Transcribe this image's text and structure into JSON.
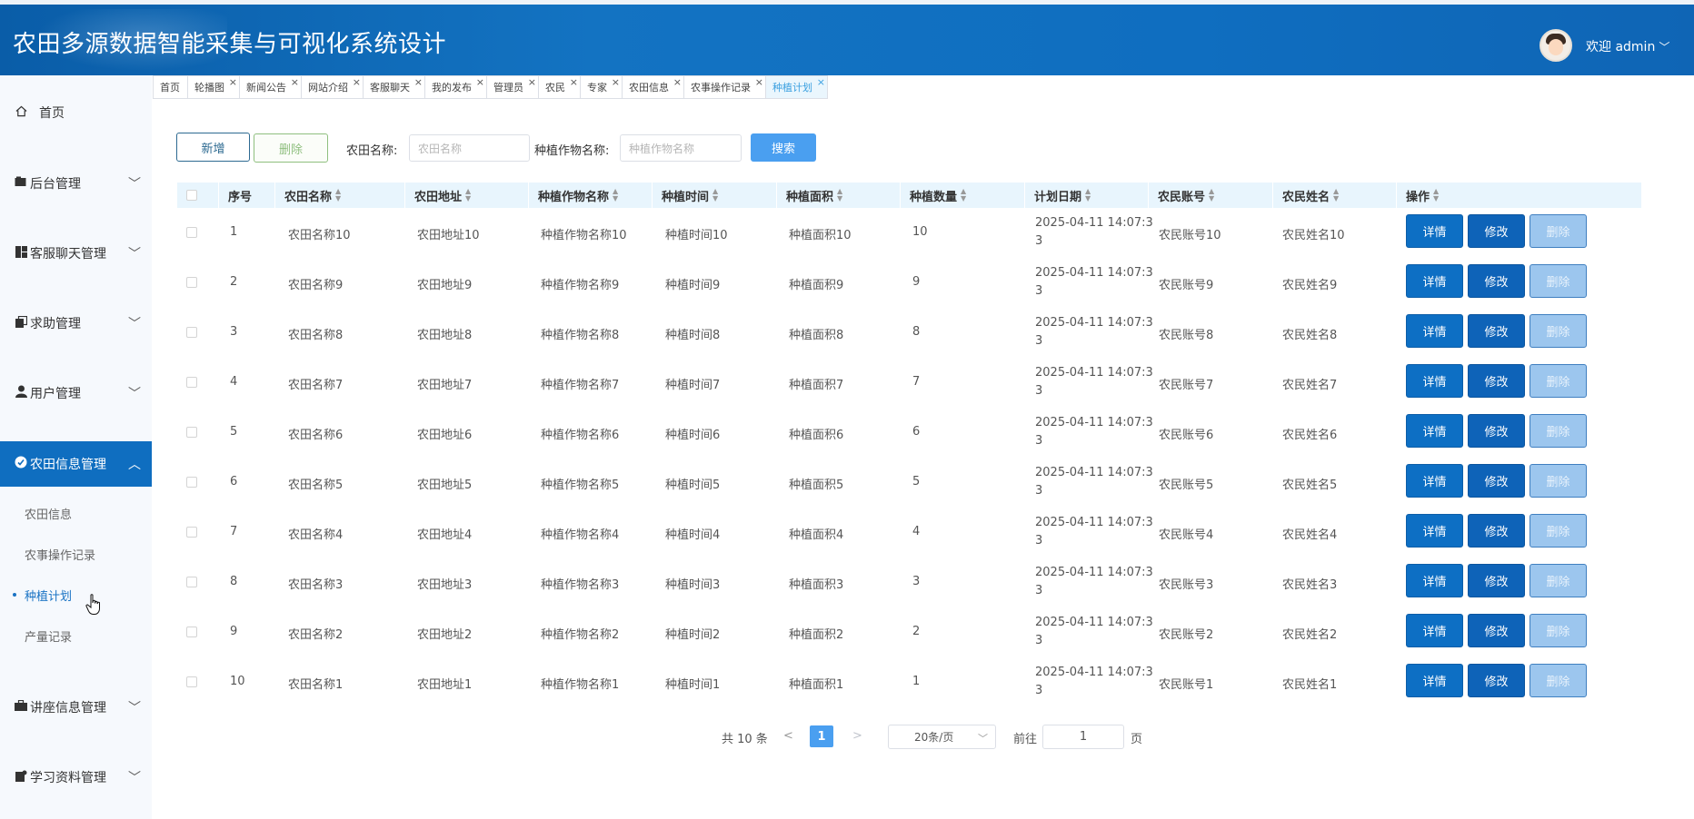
{
  "header": {
    "title": "农田多源数据智能采集与可视化系统设计",
    "greeting": "欢迎 admin",
    "chevron": "﹀"
  },
  "sidebar": {
    "items": [
      {
        "label": "首页",
        "icon": "home-icon"
      },
      {
        "label": "后台管理",
        "icon": "folder-icon"
      },
      {
        "label": "客服聊天管理",
        "icon": "dashboard-icon"
      },
      {
        "label": "求助管理",
        "icon": "copy-icon"
      },
      {
        "label": "用户管理",
        "icon": "user-icon"
      },
      {
        "label": "农田信息管理",
        "icon": "check-circle-icon"
      },
      {
        "label": "讲座信息管理",
        "icon": "briefcase-icon"
      },
      {
        "label": "学习资料管理",
        "icon": "note-icon"
      }
    ],
    "subitems": [
      "农田信息",
      "农事操作记录",
      "种植计划",
      "产量记录"
    ]
  },
  "tabs": [
    "首页",
    "轮播图",
    "新闻公告",
    "网站介绍",
    "客服聊天",
    "我的发布",
    "管理员",
    "农民",
    "专家",
    "农田信息",
    "农事操作记录",
    "种植计划"
  ],
  "toolbar": {
    "add_label": "新增",
    "delete_label": "删除",
    "field_name_label": "农田名称:",
    "field_name_placeholder": "农田名称",
    "crop_name_label": "种植作物名称:",
    "crop_name_placeholder": "种植作物名称",
    "search_label": "搜索"
  },
  "table": {
    "columns": [
      "序号",
      "农田名称",
      "农田地址",
      "种植作物名称",
      "种植时间",
      "种植面积",
      "种植数量",
      "计划日期",
      "农民账号",
      "农民姓名",
      "操作"
    ],
    "rows": [
      {
        "no": "1",
        "name": "农田名称10",
        "addr": "农田地址10",
        "crop": "种植作物名称10",
        "time": "种植时间10",
        "area": "种植面积10",
        "qty": "10",
        "date1": "2025-04-11 14:07:3",
        "date2": "3",
        "account": "农民账号10",
        "farmer": "农民姓名10"
      },
      {
        "no": "2",
        "name": "农田名称9",
        "addr": "农田地址9",
        "crop": "种植作物名称9",
        "time": "种植时间9",
        "area": "种植面积9",
        "qty": "9",
        "date1": "2025-04-11 14:07:3",
        "date2": "3",
        "account": "农民账号9",
        "farmer": "农民姓名9"
      },
      {
        "no": "3",
        "name": "农田名称8",
        "addr": "农田地址8",
        "crop": "种植作物名称8",
        "time": "种植时间8",
        "area": "种植面积8",
        "qty": "8",
        "date1": "2025-04-11 14:07:3",
        "date2": "3",
        "account": "农民账号8",
        "farmer": "农民姓名8"
      },
      {
        "no": "4",
        "name": "农田名称7",
        "addr": "农田地址7",
        "crop": "种植作物名称7",
        "time": "种植时间7",
        "area": "种植面积7",
        "qty": "7",
        "date1": "2025-04-11 14:07:3",
        "date2": "3",
        "account": "农民账号7",
        "farmer": "农民姓名7"
      },
      {
        "no": "5",
        "name": "农田名称6",
        "addr": "农田地址6",
        "crop": "种植作物名称6",
        "time": "种植时间6",
        "area": "种植面积6",
        "qty": "6",
        "date1": "2025-04-11 14:07:3",
        "date2": "3",
        "account": "农民账号6",
        "farmer": "农民姓名6"
      },
      {
        "no": "6",
        "name": "农田名称5",
        "addr": "农田地址5",
        "crop": "种植作物名称5",
        "time": "种植时间5",
        "area": "种植面积5",
        "qty": "5",
        "date1": "2025-04-11 14:07:3",
        "date2": "3",
        "account": "农民账号5",
        "farmer": "农民姓名5"
      },
      {
        "no": "7",
        "name": "农田名称4",
        "addr": "农田地址4",
        "crop": "种植作物名称4",
        "time": "种植时间4",
        "area": "种植面积4",
        "qty": "4",
        "date1": "2025-04-11 14:07:3",
        "date2": "3",
        "account": "农民账号4",
        "farmer": "农民姓名4"
      },
      {
        "no": "8",
        "name": "农田名称3",
        "addr": "农田地址3",
        "crop": "种植作物名称3",
        "time": "种植时间3",
        "area": "种植面积3",
        "qty": "3",
        "date1": "2025-04-11 14:07:3",
        "date2": "3",
        "account": "农民账号3",
        "farmer": "农民姓名3"
      },
      {
        "no": "9",
        "name": "农田名称2",
        "addr": "农田地址2",
        "crop": "种植作物名称2",
        "time": "种植时间2",
        "area": "种植面积2",
        "qty": "2",
        "date1": "2025-04-11 14:07:3",
        "date2": "3",
        "account": "农民账号2",
        "farmer": "农民姓名2"
      },
      {
        "no": "10",
        "name": "农田名称1",
        "addr": "农田地址1",
        "crop": "种植作物名称1",
        "time": "种植时间1",
        "area": "种植面积1",
        "qty": "1",
        "date1": "2025-04-11 14:07:3",
        "date2": "3",
        "account": "农民账号1",
        "farmer": "农民姓名1"
      }
    ],
    "actions": {
      "detail": "详情",
      "edit": "修改",
      "delete": "删除"
    }
  },
  "pagination": {
    "total": "共 10 条",
    "prev": "<",
    "current": "1",
    "next": ">",
    "page_size": "20条/页",
    "goto_label": "前往",
    "goto_value": "1",
    "page_unit": "页"
  },
  "colors": {
    "header": "#0f6ec0",
    "accent": "#4a9ff0",
    "table_header": "#e8f5fd"
  }
}
